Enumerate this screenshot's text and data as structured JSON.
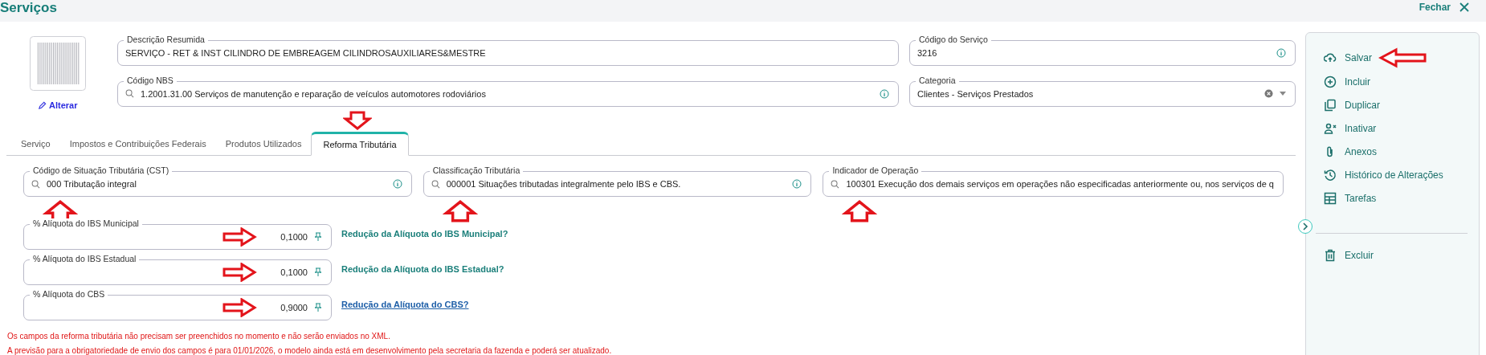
{
  "header": {
    "title": "Serviços",
    "close_label": "Fechar"
  },
  "image_link": "Alterar",
  "top_fields": [
    {
      "kind": "text",
      "label": "Descrição Resumida",
      "value": "SERVIÇO - RET & INST CILINDRO DE EMBREAGEM  CILINDROSAUXILIARES&MESTRE"
    },
    {
      "kind": "text",
      "label": "Código do Serviço",
      "value": "3216",
      "info": true
    },
    {
      "kind": "search",
      "label": "Código NBS",
      "value": "1.2001.31.00 Serviços de manutenção e reparação de veículos automotores rodoviários",
      "info": true
    },
    {
      "kind": "select",
      "label": "Categoria",
      "value": "Clientes - Serviços Prestados"
    }
  ],
  "tabs": [
    {
      "label": "Serviço",
      "selected": false
    },
    {
      "label": "Impostos e Contribuições Federais",
      "selected": false
    },
    {
      "label": "Produtos Utilizados",
      "selected": false
    },
    {
      "label": "Reforma Tributária",
      "selected": true,
      "arrow": true
    }
  ],
  "tax_fields": [
    {
      "label": "Código de Situação Tributária (CST)",
      "value": "000 Tributação integral",
      "info": true,
      "arrow": true
    },
    {
      "label": "Classificação Tributária",
      "value": "000001 Situações tributadas integralmente pelo IBS e CBS.",
      "info": true,
      "arrow": true
    },
    {
      "label": "Indicador de Operação",
      "value": "100301 Execução dos demais serviços em operações não especificadas anteriormente ou, nos serviços de q",
      "arrow": true
    }
  ],
  "rate_fields": [
    {
      "label": "% Alíquota do IBS Municipal",
      "value": "0,1000",
      "link": "Redução da Alíquota do IBS Municipal?",
      "link_underlined": false,
      "arrow": true
    },
    {
      "label": "% Alíquota do IBS Estadual",
      "value": "0,1000",
      "link": "Redução da Alíquota do IBS Estadual?",
      "link_underlined": false,
      "arrow": true
    },
    {
      "label": "% Alíquota do CBS",
      "value": "0,9000",
      "link": "Redução da Alíquota do CBS?",
      "link_underlined": true,
      "arrow": true
    }
  ],
  "notes": [
    "Os campos da reforma tributária não precisam ser preenchidos no momento e não serão enviados no XML.",
    "A previsão para a obrigatoriedade de envio dos campos é para 01/01/2026, o modelo ainda está em desenvolvimento pela secretaria da fazenda e poderá ser atualizado."
  ],
  "actions": [
    {
      "kind": "save",
      "label": "Salvar",
      "arrow": true
    },
    {
      "kind": "add",
      "label": "Incluir"
    },
    {
      "kind": "copy",
      "label": "Duplicar"
    },
    {
      "kind": "deactivate",
      "label": "Inativar"
    },
    {
      "kind": "attach",
      "label": "Anexos"
    },
    {
      "kind": "history",
      "label": "Histórico de Alterações"
    },
    {
      "kind": "table",
      "label": "Tarefas"
    }
  ],
  "danger_actions": [
    {
      "kind": "delete",
      "label": "Excluir"
    }
  ]
}
